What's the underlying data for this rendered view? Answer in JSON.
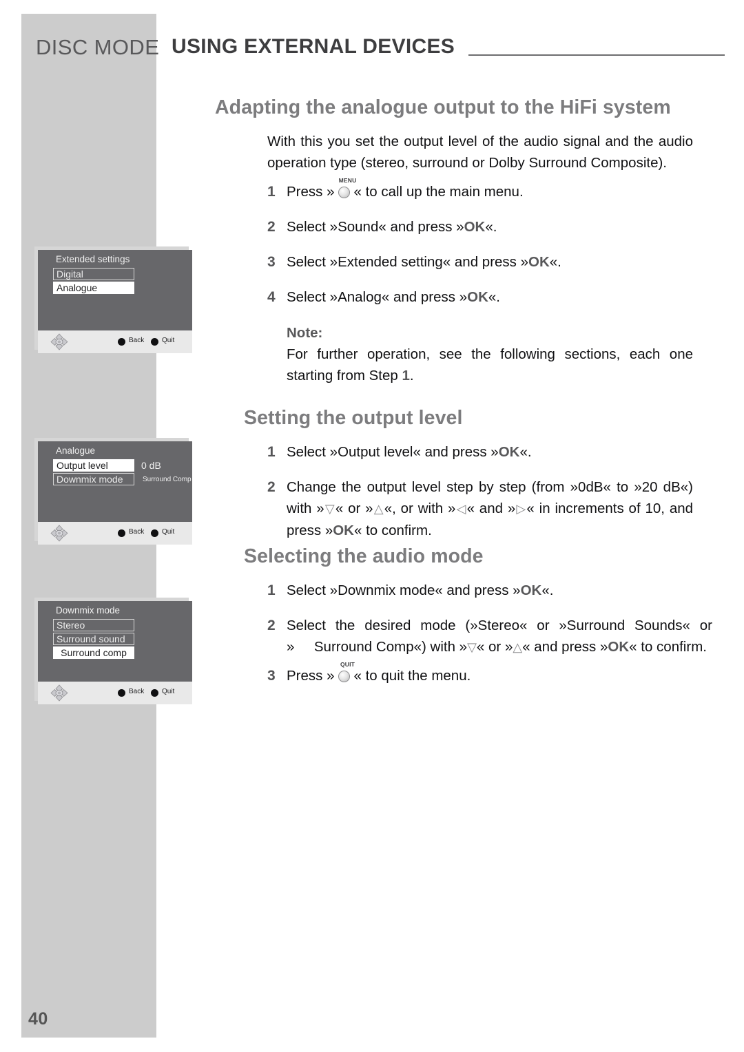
{
  "page": {
    "number": "40",
    "header": {
      "mode": "DISC MODE",
      "title": "USING EXTERNAL DEVICES"
    }
  },
  "sections": [
    {
      "heading": "Adapting the analogue output to the HiFi system",
      "intro": "With this you set the output level of the audio signal and the audio operation type (stereo, surround or Dolby Surround Composite).",
      "steps": [
        {
          "num": "1",
          "text_before_key": "Press »",
          "key": "MENU",
          "text_after_key": "« to call up the main menu."
        },
        {
          "num": "2",
          "text": "Select »Sound« and press »OK«."
        },
        {
          "num": "3",
          "text": "Select »Extended setting« and press »OK«."
        },
        {
          "num": "4",
          "text": "Select »Analog« and press »OK«."
        }
      ],
      "note": {
        "label": "Note:",
        "text": "For further operation, see the following sections, each one starting from Step 1."
      }
    },
    {
      "heading": "Setting the output level",
      "steps": [
        {
          "num": "1",
          "text": "Select »Output level« and press »OK«."
        },
        {
          "num": "2",
          "text": "Change the output level step by step (from »0dB« to »20 dB«) with »▽« or »△«, or with »◁« and »▷« in increments of 10, and press »OK« to confirm."
        }
      ]
    },
    {
      "heading": "Selecting the audio mode",
      "steps": [
        {
          "num": "1",
          "text": "Select »Downmix mode« and press »OK«."
        },
        {
          "num": "2",
          "text": "Select the desired mode (»Stereo« or »Surround Sounds« or »    Surround Comp«) with »▽« or »△« and press »OK« to confirm."
        },
        {
          "num": "3",
          "text_before_key": "Press »",
          "key": "QUIT",
          "text_after_key": "« to quit the menu."
        }
      ]
    }
  ],
  "osd_screens": [
    {
      "title": "Extended settings",
      "rows": [
        {
          "label": "Digital",
          "state": "outline",
          "value": "",
          "value_size": ""
        },
        {
          "label": "Analogue",
          "state": "selected",
          "value": "",
          "value_size": ""
        }
      ],
      "softkeys": [
        "Back",
        "Quit"
      ],
      "dpad_icon": "dpad-icon"
    },
    {
      "title": "Analogue",
      "rows": [
        {
          "label": "Output level",
          "state": "selected",
          "value": "0 dB",
          "value_size": "big"
        },
        {
          "label": "Downmix mode",
          "state": "outline",
          "value": "Surround Comp",
          "value_size": "small"
        }
      ],
      "softkeys": [
        "Back",
        "Quit"
      ],
      "dpad_icon": "dpad-icon"
    },
    {
      "title": "Downmix mode",
      "rows": [
        {
          "label": "Stereo",
          "state": "outline",
          "value": "",
          "value_size": ""
        },
        {
          "label": "Surround sound",
          "state": "outline",
          "value": "",
          "value_size": ""
        },
        {
          "label": "Surround comp",
          "state": "selected-centered",
          "value": "",
          "value_size": ""
        }
      ],
      "softkeys": [
        "Back",
        "Quit"
      ],
      "dpad_icon": "dpad-icon"
    }
  ],
  "colors": {
    "band": "#cccccc",
    "heading": "#7c7c7e",
    "osd_body": "#67676a",
    "osd_bar": "#e9e9e9",
    "body_text": "#111113"
  }
}
